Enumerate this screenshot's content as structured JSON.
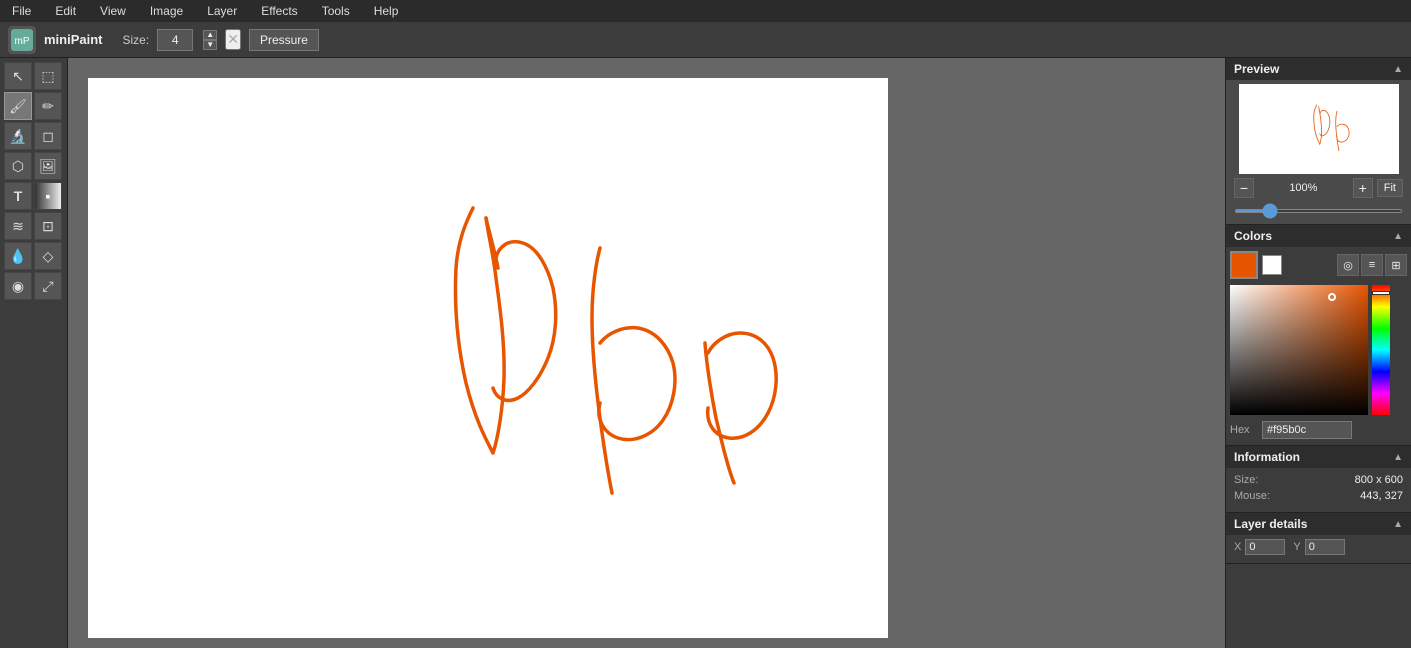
{
  "menu": {
    "items": [
      "File",
      "Edit",
      "View",
      "Image",
      "Layer",
      "Effects",
      "Tools",
      "Help"
    ]
  },
  "toolbar": {
    "app_title": "miniPaint",
    "size_label": "Size:",
    "size_value": "4",
    "pressure_label": "Pressure"
  },
  "preview": {
    "title": "Preview",
    "zoom_value": "100%",
    "fit_label": "Fit"
  },
  "colors": {
    "title": "Colors",
    "hex_label": "Hex",
    "hex_value": "#f95b0c",
    "main_color": "#e85500",
    "bg_color": "#ffffff"
  },
  "information": {
    "title": "Information",
    "size_label": "Size:",
    "size_value": "800 x 600",
    "mouse_label": "Mouse:",
    "mouse_value": "443, 327"
  },
  "layer_details": {
    "title": "Layer details",
    "x_label": "X",
    "x_value": "0",
    "y_label": "Y",
    "y_value": "0"
  },
  "tools": [
    {
      "name": "select-tool",
      "icon": "↖",
      "active": false
    },
    {
      "name": "marquee-tool",
      "icon": "⬚",
      "active": false
    },
    {
      "name": "brush-tool",
      "icon": "✏",
      "active": true
    },
    {
      "name": "pencil-tool",
      "icon": "✒",
      "active": false
    },
    {
      "name": "eyedropper-tool",
      "icon": "💧",
      "active": false
    },
    {
      "name": "eraser-tool",
      "icon": "◻",
      "active": false
    },
    {
      "name": "fill-tool",
      "icon": "⬡",
      "active": false
    },
    {
      "name": "image-tool",
      "icon": "🖼",
      "active": false
    },
    {
      "name": "text-tool",
      "icon": "T",
      "active": false
    },
    {
      "name": "dark-tool",
      "icon": "◼",
      "active": false
    },
    {
      "name": "blur-tool",
      "icon": "≋",
      "active": false
    },
    {
      "name": "crop-tool",
      "icon": "⊡",
      "active": false
    },
    {
      "name": "drop-tool",
      "icon": "💧",
      "active": false
    },
    {
      "name": "gem-tool",
      "icon": "◇",
      "active": false
    },
    {
      "name": "stamp-tool",
      "icon": "◉",
      "active": false
    },
    {
      "name": "pen-tool",
      "icon": "⊕",
      "active": false
    }
  ]
}
